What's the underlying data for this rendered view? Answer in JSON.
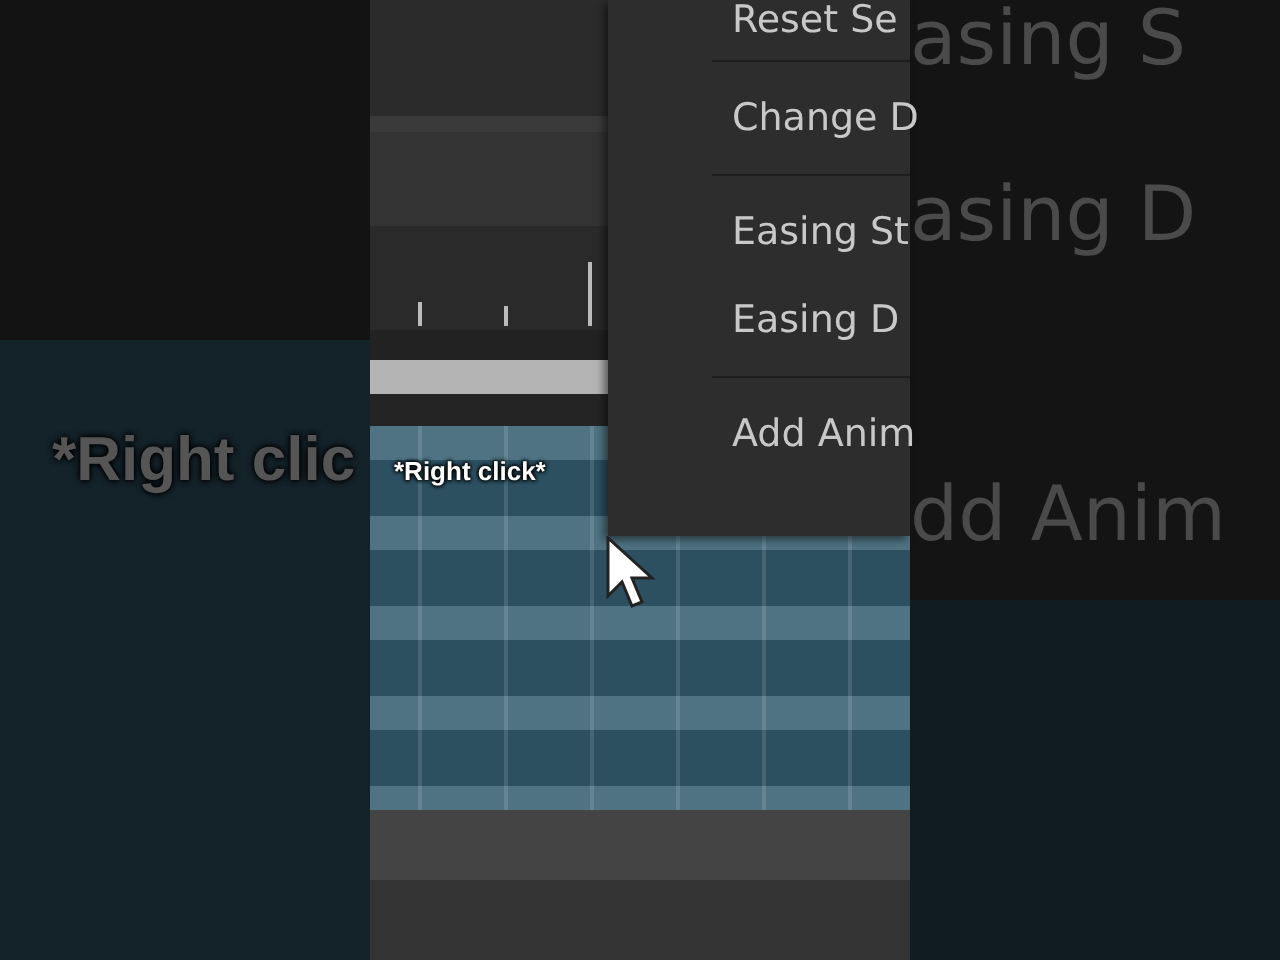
{
  "backdrop_left": {
    "caption": "*Right clic"
  },
  "backdrop_right": {
    "texts": [
      "asing S",
      "asing D",
      "dd Anim"
    ]
  },
  "timeline": {
    "caption": "*Right click*"
  },
  "context_menu": {
    "groups": [
      {
        "items": [
          "Reset Se"
        ]
      },
      {
        "items": [
          "Change D"
        ]
      },
      {
        "items": [
          "Easing St",
          "Easing D"
        ]
      },
      {
        "items": [
          "Add Anim"
        ]
      }
    ]
  }
}
